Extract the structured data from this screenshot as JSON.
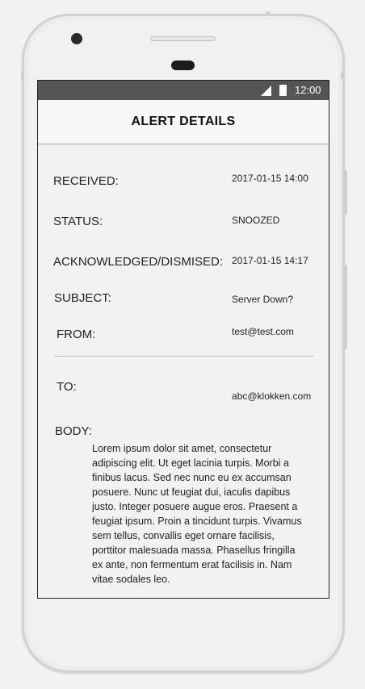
{
  "status_bar": {
    "time": "12:00",
    "signal_icon": "signal-icon",
    "battery_icon": "battery-icon"
  },
  "app_bar": {
    "title": "ALERT DETAILS"
  },
  "details": {
    "received_label": "RECEIVED:",
    "received_value": "2017-01-15 14:00",
    "status_label": "STATUS:",
    "status_value": "SNOOZED",
    "ack_label": "ACKNOWLEDGED/DISMISED:",
    "ack_value": "2017-01-15 14:17",
    "subject_label": "SUBJECT:",
    "subject_value": "Server Down?",
    "from_label": "FROM:",
    "from_value": "test@test.com",
    "to_label": "TO:",
    "to_value": "abc@klokken.com",
    "body_label": "BODY:",
    "body_value": "Lorem ipsum dolor sit amet, consectetur adipiscing elit. Ut eget lacinia turpis. Morbi a finibus lacus. Sed nec nunc eu ex accumsan posuere. Nunc ut feugiat dui, iaculis dapibus justo. Integer posuere augue eros. Praesent a feugiat ipsum. Proin a tincidunt turpis. Vivamus sem tellus, convallis eget ornare facilisis, porttitor malesuada massa. Phasellus fringilla ex ante, non fermentum erat facilisis in. Nam vitae sodales leo."
  }
}
